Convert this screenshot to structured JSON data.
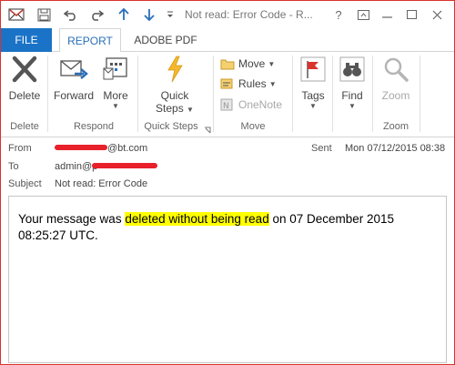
{
  "titlebar": {
    "title": "Not read: Error Code - R...",
    "help": "?",
    "restore_ribbon": "⊡",
    "minimize": "—",
    "maximize": "▢",
    "close": "✕"
  },
  "tabs": {
    "file": "FILE",
    "report": "REPORT",
    "adobe_pdf": "ADOBE PDF"
  },
  "ribbon": {
    "delete_label": "Delete",
    "forward_label": "Forward",
    "more_label": "More",
    "quick_steps_label_1": "Quick",
    "quick_steps_label_2": "Steps",
    "move_label": "Move",
    "rules_label": "Rules",
    "onenote_label": "OneNote",
    "tags_label": "Tags",
    "find_label": "Find",
    "zoom_label": "Zoom",
    "groups": {
      "delete": "Delete",
      "respond": "Respond",
      "quick_steps": "Quick Steps",
      "move": "Move",
      "zoom": "Zoom"
    }
  },
  "header": {
    "from_label": "From",
    "from_value": "@bt.com",
    "to_label": "To",
    "to_value": "admin@p",
    "subject_label": "Subject",
    "subject_value": "Not read: Error Code",
    "sent_label": "Sent",
    "sent_value": "Mon 07/12/2015 08:38"
  },
  "message": {
    "part1": "Your message was ",
    "highlight": "deleted without being read",
    "part2": " on 07 December 2015 08:25:27 UTC."
  },
  "colors": {
    "accent": "#1a73c7",
    "redaction": "#e8202a",
    "highlight": "#ffff00",
    "window_border": "#d9332b"
  }
}
